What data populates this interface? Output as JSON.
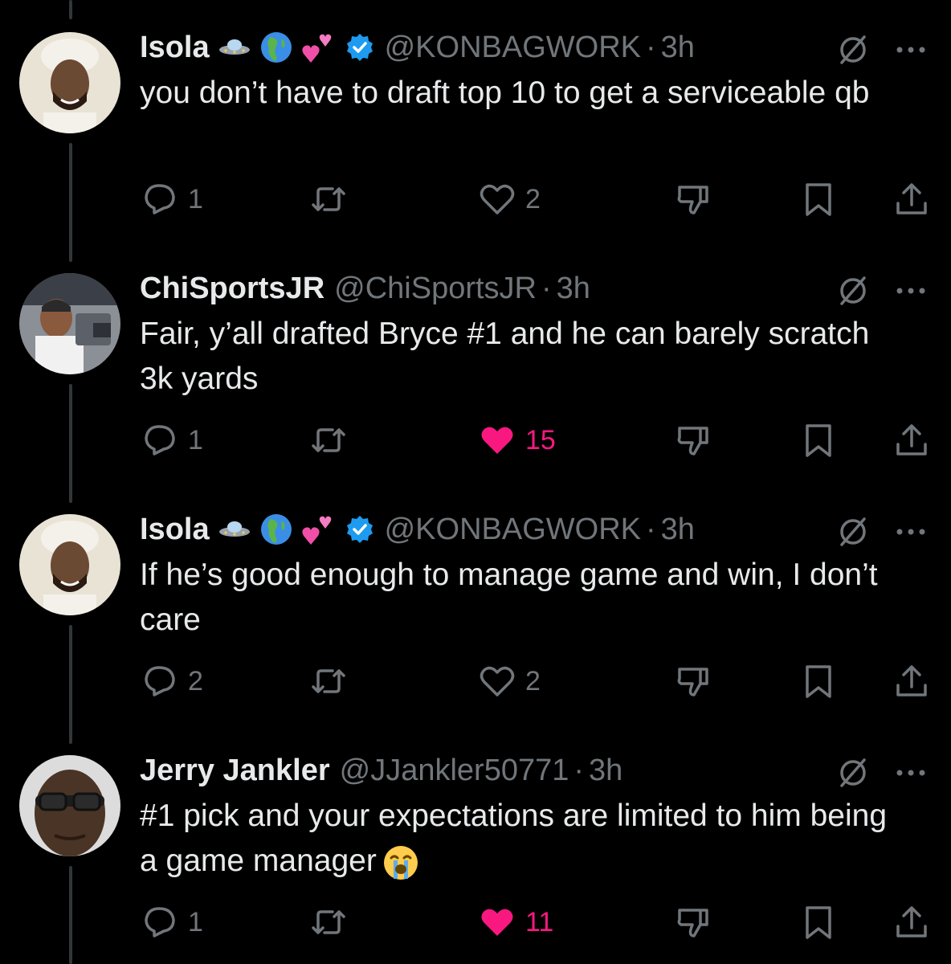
{
  "tweets": [
    {
      "name": "Isola",
      "emojis": [
        "flying-saucer-emoji",
        "globe-africa-emoji",
        "two-hearts-emoji"
      ],
      "verified": true,
      "handle": "@KONBAGWORK",
      "time": "3h",
      "text": "you don’t have to draft top 10 to get a serviceable qb",
      "text_emoji": null,
      "replies": "1",
      "retweets": "",
      "likes": "2",
      "liked": false
    },
    {
      "name": "ChiSportsJR",
      "emojis": [],
      "verified": false,
      "handle": "@ChiSportsJR",
      "time": "3h",
      "text": "Fair, y’all drafted Bryce #1 and he can barely scratch 3k yards",
      "text_emoji": null,
      "replies": "1",
      "retweets": "",
      "likes": "15",
      "liked": true
    },
    {
      "name": "Isola",
      "emojis": [
        "flying-saucer-emoji",
        "globe-africa-emoji",
        "two-hearts-emoji"
      ],
      "verified": true,
      "handle": "@KONBAGWORK",
      "time": "3h",
      "text": "If he’s good enough to manage game and win, I don’t care",
      "text_emoji": null,
      "replies": "2",
      "retweets": "",
      "likes": "2",
      "liked": false
    },
    {
      "name": "Jerry Jankler",
      "emojis": [],
      "verified": false,
      "handle": "@JJankler50771",
      "time": "3h",
      "text": "#1 pick and your expectations are limited to him being a game manager",
      "text_emoji": "loudly-crying-face-emoji",
      "replies": "1",
      "retweets": "",
      "likes": "11",
      "liked": true
    }
  ],
  "dot_separator": "·",
  "colors": {
    "background": "#000000",
    "text": "#e7e9ea",
    "muted": "#71767b",
    "like": "#f91880",
    "verified": "#1d9bf0",
    "thread_line": "#333639"
  }
}
